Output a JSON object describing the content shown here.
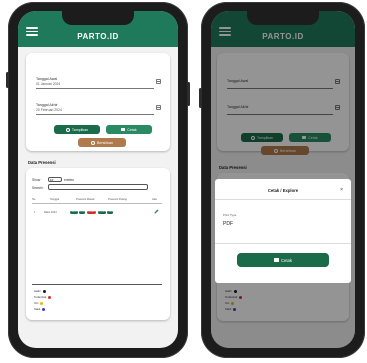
{
  "app": {
    "title": "PARTO.ID"
  },
  "form": {
    "start_label": "Tanggal Awal",
    "start_value": "01 Januari 2024",
    "end_label": "Tanggal Akhir",
    "end_value": "20 Februari 2024"
  },
  "buttons": {
    "show": "Tampilkan",
    "print": "Cetak",
    "reset": "Bersihkan"
  },
  "table": {
    "section_title": "Data Presensi",
    "show_label": "Show",
    "entries_value": "10",
    "entries_label": "entries",
    "search_label": "Search:",
    "headers": [
      "No",
      "Tanggal",
      "Presensi Masuk",
      "Presensi Pulang",
      "Aksi"
    ],
    "row_no": "1",
    "row_date": "Rabu 2024",
    "row_pills": [
      "08:00",
      "ON",
      "TELAT",
      "16:00",
      "ON"
    ]
  },
  "legend": [
    {
      "label": "Hadir",
      "color": "#1a1a1a"
    },
    {
      "label": "Terlambat",
      "color": "#d32f2f"
    },
    {
      "label": "Izin",
      "color": "#f5b700"
    },
    {
      "label": "Sakit",
      "color": "#3b3bd6"
    }
  ],
  "modal": {
    "title": "Cetak / Explore",
    "close": "×",
    "type_label": "Print Type",
    "type_value": "PDF",
    "button": "Cetak"
  },
  "colors": {
    "primary": "#1e7a5a",
    "dark": "#1a6b4a",
    "brown": "#b07a4d"
  }
}
